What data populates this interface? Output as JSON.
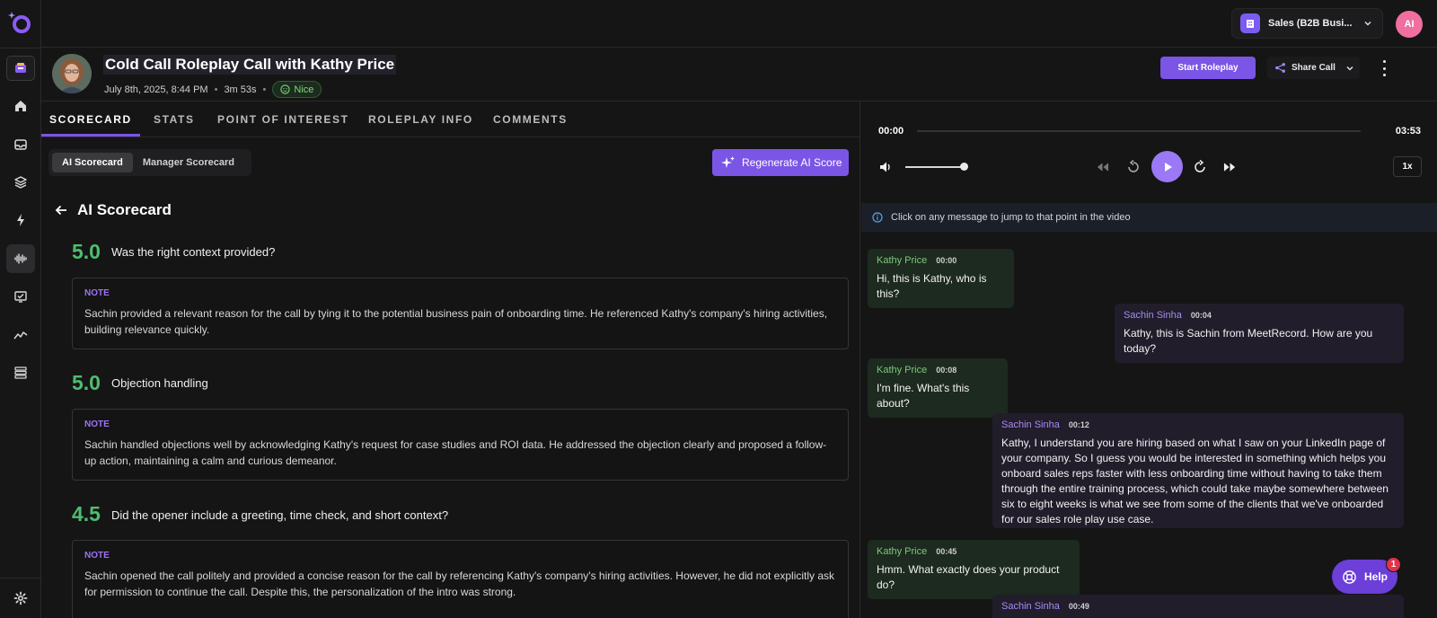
{
  "sidebar": {
    "items": [
      {
        "icon": "home-icon"
      },
      {
        "icon": "inbox-icon"
      },
      {
        "icon": "layers-icon"
      },
      {
        "icon": "lightning-icon"
      },
      {
        "icon": "soundwave-icon",
        "active": true
      },
      {
        "icon": "presentation-check-icon"
      },
      {
        "icon": "trend-line-icon"
      },
      {
        "icon": "stack-list-icon"
      }
    ],
    "settings_icon": "gear-icon"
  },
  "topbar": {
    "workspace_label": "Sales (B2B Busi...",
    "user_initials": "AI"
  },
  "header": {
    "title": "Cold Call Roleplay Call with Kathy Price",
    "date": "July 8th, 2025, 8:44 PM",
    "duration": "3m 53s",
    "sentiment": "Nice",
    "start_label": "Start Roleplay",
    "share_label": "Share Call"
  },
  "tabs": [
    "SCORECARD",
    "STATS",
    "POINT OF INTEREST",
    "ROLEPLAY INFO",
    "COMMENTS"
  ],
  "scorecard": {
    "segment": [
      "AI Scorecard",
      "Manager Scorecard"
    ],
    "regen_label": "Regenerate AI Score",
    "heading": "AI Scorecard",
    "criteria": [
      {
        "score": "5.0",
        "title": "Was the right context provided?",
        "note_label": "NOTE",
        "note": "Sachin provided a relevant reason for the call by tying it to the potential business pain of onboarding time. He referenced Kathy's company's hiring activities, building relevance quickly."
      },
      {
        "score": "5.0",
        "title": "Objection handling",
        "note_label": "NOTE",
        "note": "Sachin handled objections well by acknowledging Kathy's request for case studies and ROI data. He addressed the objection clearly and proposed a follow-up action, maintaining a calm and curious demeanor."
      },
      {
        "score": "4.5",
        "title": "Did the opener include a greeting, time check, and short context?",
        "note_label": "NOTE",
        "note": "Sachin opened the call politely and provided a concise reason for the call by referencing Kathy's company's hiring activities. However, he did not explicitly ask for permission to continue the call. Despite this, the personalization of the intro was strong."
      }
    ]
  },
  "player": {
    "current_time": "00:00",
    "total_time": "03:53",
    "progress": 0,
    "volume": 0.93,
    "speed": "1x"
  },
  "transcript": {
    "info": "Click on any message to jump to that point in the video",
    "messages": [
      {
        "speaker": "Kathy Price",
        "time": "00:00",
        "text": "Hi, this is Kathy, who is this?"
      },
      {
        "speaker": "Sachin Sinha",
        "time": "00:04",
        "text": "Kathy, this is Sachin from MeetRecord. How are you today?"
      },
      {
        "speaker": "Kathy Price",
        "time": "00:08",
        "text": "I'm fine. What's this about?"
      },
      {
        "speaker": "Sachin Sinha",
        "time": "00:12",
        "text": "Kathy, I understand you are hiring based on what I saw on your LinkedIn page of your company. So I guess you would be interested in something which helps you onboard sales reps faster with less onboarding time without having to take them through the entire training process, which could take maybe somewhere between six to eight weeks is what we see from some of the clients that we've onboarded for our sales role play use case."
      },
      {
        "speaker": "Kathy Price",
        "time": "00:45",
        "text": "Hmm. What exactly does your product do?"
      },
      {
        "speaker": "Sachin Sinha",
        "time": "00:49",
        "text": ""
      }
    ]
  },
  "help": {
    "label": "Help",
    "badge": "1"
  },
  "colors": {
    "accent": "#7b55e6",
    "score_green": "#4fbd6f",
    "kathy": "#7cc97c",
    "sachin": "#a88af5"
  }
}
